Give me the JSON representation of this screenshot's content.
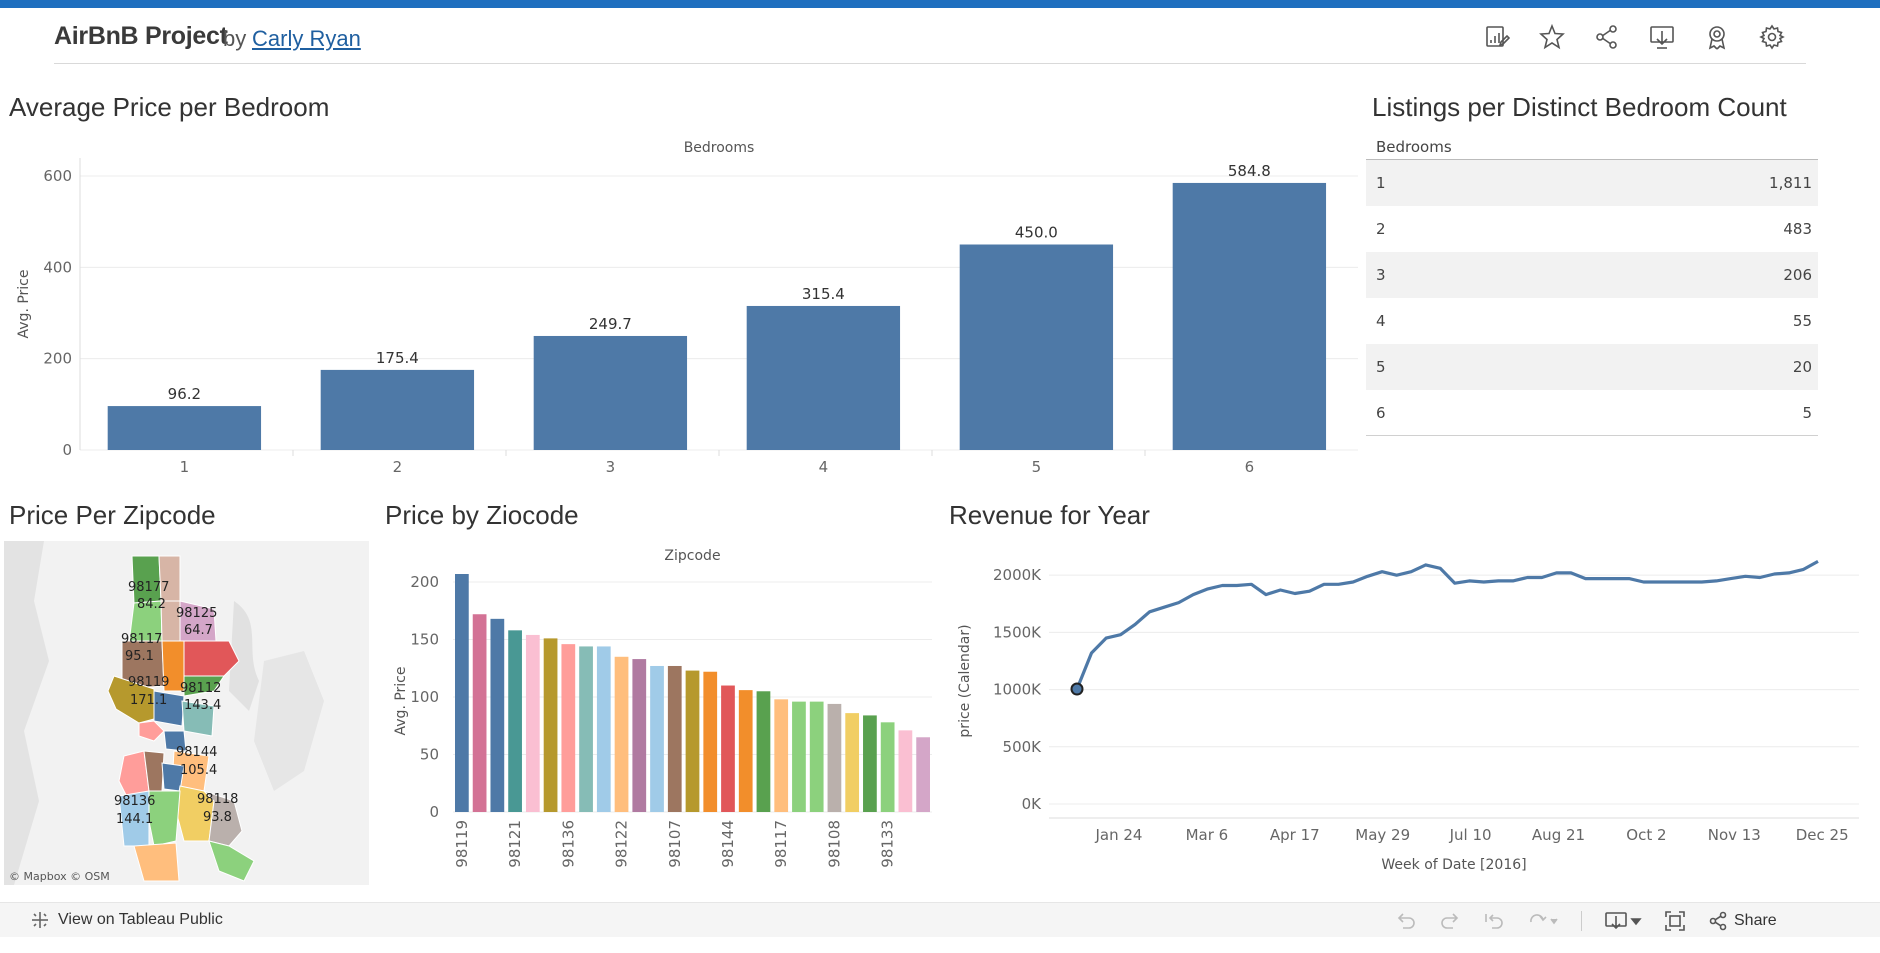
{
  "header": {
    "title": "AirBnB Project",
    "by": "by",
    "author": "Carly Ryan",
    "icons": [
      "edit-report-icon",
      "star-icon",
      "share-nodes-icon",
      "download-icon",
      "award-icon",
      "gear-icon"
    ]
  },
  "panels": {
    "avg_price_title": "Average Price per Bedroom",
    "listings_title": "Listings per Distinct Bedroom Count",
    "zip_map_title": "Price Per Zipcode",
    "zip_bar_title": "Price by Ziocode",
    "revenue_title": "Revenue for Year"
  },
  "chart_data": [
    {
      "type": "bar",
      "title": "Average Price per Bedroom",
      "top_label": "Bedrooms",
      "ylabel": "Avg. Price",
      "categories": [
        "1",
        "2",
        "3",
        "4",
        "5",
        "6"
      ],
      "values": [
        96.2,
        175.4,
        249.7,
        315.4,
        450.0,
        584.8
      ],
      "value_labels": [
        "96.2",
        "175.4",
        "249.7",
        "315.4",
        "450.0",
        "584.8"
      ],
      "yticks": [
        0,
        200,
        400,
        600
      ],
      "ylim": [
        0,
        600
      ],
      "color": "#4e79a7",
      "grid": true
    },
    {
      "type": "table",
      "title": "Listings per Distinct Bedroom Count",
      "column": "Bedrooms",
      "rows": [
        {
          "bedrooms": "1",
          "count": "1,811"
        },
        {
          "bedrooms": "2",
          "count": "483"
        },
        {
          "bedrooms": "3",
          "count": "206"
        },
        {
          "bedrooms": "4",
          "count": "55"
        },
        {
          "bedrooms": "5",
          "count": "20"
        },
        {
          "bedrooms": "6",
          "count": "5"
        }
      ]
    },
    {
      "type": "bar",
      "title": "Price by Ziocode",
      "top_label": "Zipcode",
      "ylabel": "Avg. Price",
      "values": [
        207,
        172,
        168,
        158,
        154,
        151,
        146,
        144,
        144,
        135,
        133,
        127,
        127,
        123,
        122,
        110,
        106,
        105,
        98,
        96,
        96,
        94,
        86,
        84,
        78,
        71,
        65
      ],
      "colors": [
        "#4e79a7",
        "#d37295",
        "#4e79a7",
        "#499894",
        "#fabfd2",
        "#b6992d",
        "#ff9d9a",
        "#86bcb6",
        "#a0cbe8",
        "#ffbe7d",
        "#b07aa1",
        "#a0cbe8",
        "#9d7660",
        "#b6992d",
        "#f28e2b",
        "#e15759",
        "#f28e2b",
        "#59a14f",
        "#ffbe7d",
        "#8cd17d",
        "#8cd17d",
        "#bab0ac",
        "#f1ce63",
        "#59a14f",
        "#8cd17d",
        "#fabfd2",
        "#d4a6c8"
      ],
      "tick_labels": [
        "98119",
        "98121",
        "98136",
        "98122",
        "98107",
        "98144",
        "98117",
        "98108",
        "98133"
      ],
      "yticks": [
        0,
        50,
        100,
        150,
        200
      ],
      "ylim": [
        0,
        207
      ]
    },
    {
      "type": "line",
      "title": "Revenue for Year",
      "xlabel": "Week of Date [2016]",
      "ylabel": "price (Calendar)",
      "x_tick_labels": [
        "Jan 24",
        "Mar 6",
        "Apr 17",
        "May 29",
        "Jul 10",
        "Aug 21",
        "Oct 2",
        "Nov 13",
        "Dec 25"
      ],
      "y_tick_labels": [
        "0K",
        "500K",
        "1000K",
        "1500K",
        "2000K"
      ],
      "yticks": [
        0,
        500000,
        1000000,
        1500000,
        2000000
      ],
      "ylim": [
        0,
        2150000
      ],
      "values": [
        1005000,
        1320000,
        1450000,
        1480000,
        1570000,
        1680000,
        1720000,
        1760000,
        1830000,
        1880000,
        1910000,
        1910000,
        1920000,
        1830000,
        1870000,
        1840000,
        1860000,
        1920000,
        1920000,
        1940000,
        1990000,
        2030000,
        2000000,
        2030000,
        2090000,
        2060000,
        1930000,
        1950000,
        1940000,
        1950000,
        1950000,
        1980000,
        1980000,
        2020000,
        2020000,
        1970000,
        1970000,
        1970000,
        1970000,
        1940000,
        1940000,
        1940000,
        1940000,
        1940000,
        1950000,
        1970000,
        1990000,
        1980000,
        2010000,
        2020000,
        2050000,
        2120000
      ],
      "color": "#4e79a7"
    }
  ],
  "map": {
    "labels": [
      {
        "zip": "98177",
        "price": "84.2"
      },
      {
        "zip": "98125",
        "price": "64.7"
      },
      {
        "zip": "98117",
        "price": "95.1"
      },
      {
        "zip": "98119",
        "price": "171.1"
      },
      {
        "zip": "98112",
        "price": "143.4"
      },
      {
        "zip": "98144",
        "price": "105.4"
      },
      {
        "zip": "98136",
        "price": "144.1"
      },
      {
        "zip": "98118",
        "price": "93.8"
      }
    ],
    "attribution": "© Mapbox  © OSM"
  },
  "footer": {
    "view_link": "View on Tableau Public",
    "share": "Share"
  }
}
